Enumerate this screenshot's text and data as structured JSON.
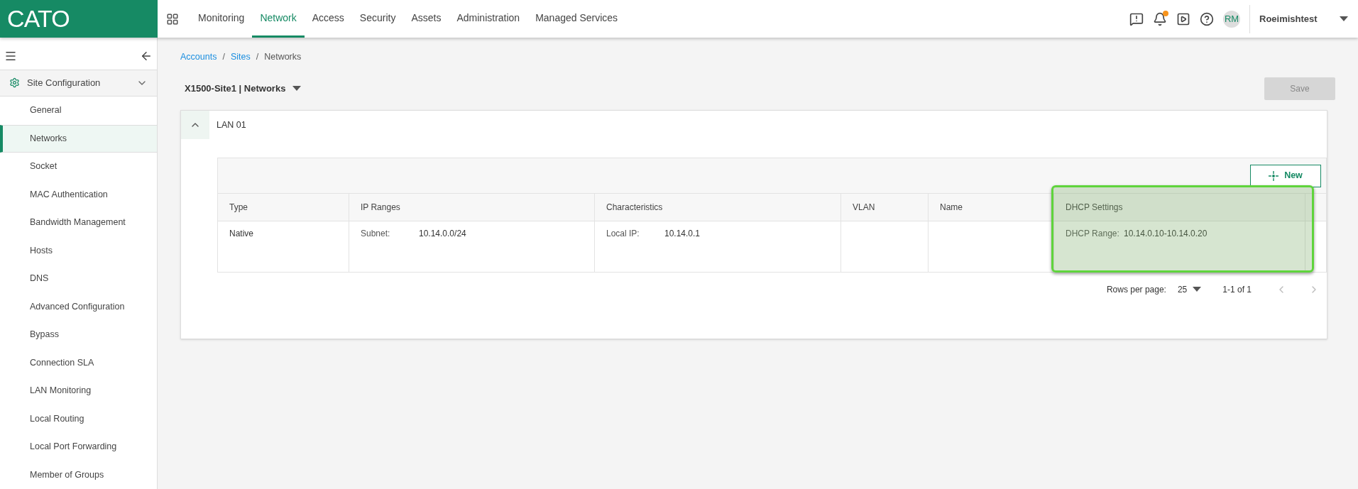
{
  "logo": "CATO",
  "nav": [
    {
      "label": "Monitoring",
      "selected": false
    },
    {
      "label": "Network",
      "selected": true
    },
    {
      "label": "Access",
      "selected": false
    },
    {
      "label": "Security",
      "selected": false
    },
    {
      "label": "Assets",
      "selected": false
    },
    {
      "label": "Administration",
      "selected": false
    },
    {
      "label": "Managed Services",
      "selected": false
    }
  ],
  "user": {
    "initials": "RM",
    "name": "Roeimishtest",
    "notification": true
  },
  "sidebar": {
    "section": "Site Configuration",
    "expanded": true,
    "items": [
      {
        "label": "General",
        "selected": false
      },
      {
        "label": "Networks",
        "selected": true
      },
      {
        "label": "Socket",
        "selected": false
      },
      {
        "label": "MAC Authentication",
        "selected": false
      },
      {
        "label": "Bandwidth Management",
        "selected": false
      },
      {
        "label": "Hosts",
        "selected": false
      },
      {
        "label": "DNS",
        "selected": false
      },
      {
        "label": "Advanced Configuration",
        "selected": false
      },
      {
        "label": "Bypass",
        "selected": false
      },
      {
        "label": "Connection SLA",
        "selected": false
      },
      {
        "label": "LAN Monitoring",
        "selected": false
      },
      {
        "label": "Local Routing",
        "selected": false
      },
      {
        "label": "Local Port Forwarding",
        "selected": false
      },
      {
        "label": "Member of Groups",
        "selected": false
      }
    ]
  },
  "breadcrumb": {
    "separator": "/",
    "items": [
      {
        "label": "Accounts",
        "link": true
      },
      {
        "label": "Sites",
        "link": true
      },
      {
        "label": "Networks",
        "link": false
      }
    ]
  },
  "page_title": "X1500-Site1 | Networks",
  "save_button": {
    "label": "Save",
    "disabled": true
  },
  "panel": {
    "title": "LAN 01",
    "expanded": true,
    "new_button": "New",
    "table": {
      "columns": [
        {
          "label": "Type",
          "highlighted": false
        },
        {
          "label": "IP Ranges",
          "highlighted": false
        },
        {
          "label": "Characteristics",
          "highlighted": false
        },
        {
          "label": "VLAN",
          "highlighted": false
        },
        {
          "label": "Name",
          "highlighted": false
        },
        {
          "label": "DHCP Settings",
          "highlighted": true
        }
      ],
      "rows": [
        {
          "cells": [
            {
              "value": "Native"
            },
            {
              "label": "Subnet:",
              "value": "10.14.0.0/24"
            },
            {
              "label": "Local IP:",
              "value": "10.14.0.1"
            },
            {},
            {},
            {
              "label": "DHCP Range:",
              "value": "10.14.0.10-10.14.0.20"
            }
          ]
        }
      ]
    },
    "pagination": {
      "label": "Rows per page:",
      "rows_per_page": "25",
      "range": "1-1 of 1"
    }
  }
}
